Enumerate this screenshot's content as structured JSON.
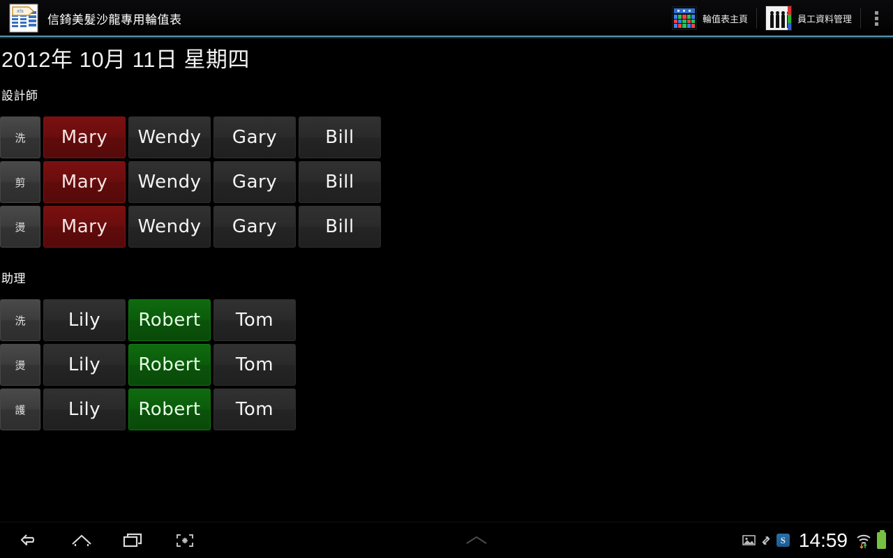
{
  "action_bar": {
    "app_icon": "spreadsheet-app-icon",
    "title": "信錡美髮沙龍專用輪值表",
    "actions": [
      {
        "icon": "calendar-grid-icon",
        "label": "輪值表主頁"
      },
      {
        "icon": "staff-people-icon",
        "label": "員工資料管理"
      }
    ],
    "overflow": "overflow-menu-icon",
    "underline_color": "#5a93ad"
  },
  "content": {
    "date_header": "2012年 10月 11日 星期四",
    "sections": [
      {
        "label": "設計師",
        "rows": [
          {
            "label": "洗",
            "cells": [
              {
                "name": "Mary",
                "highlight": "red"
              },
              {
                "name": "Wendy",
                "highlight": "none"
              },
              {
                "name": "Gary",
                "highlight": "none"
              },
              {
                "name": "Bill",
                "highlight": "none"
              }
            ]
          },
          {
            "label": "剪",
            "cells": [
              {
                "name": "Mary",
                "highlight": "red"
              },
              {
                "name": "Wendy",
                "highlight": "none"
              },
              {
                "name": "Gary",
                "highlight": "none"
              },
              {
                "name": "Bill",
                "highlight": "none"
              }
            ]
          },
          {
            "label": "燙",
            "cells": [
              {
                "name": "Mary",
                "highlight": "red"
              },
              {
                "name": "Wendy",
                "highlight": "none"
              },
              {
                "name": "Gary",
                "highlight": "none"
              },
              {
                "name": "Bill",
                "highlight": "none"
              }
            ]
          }
        ]
      },
      {
        "label": "助理",
        "rows": [
          {
            "label": "洗",
            "cells": [
              {
                "name": "Lily",
                "highlight": "none"
              },
              {
                "name": "Robert",
                "highlight": "green"
              },
              {
                "name": "Tom",
                "highlight": "none"
              }
            ]
          },
          {
            "label": "燙",
            "cells": [
              {
                "name": "Lily",
                "highlight": "none"
              },
              {
                "name": "Robert",
                "highlight": "green"
              },
              {
                "name": "Tom",
                "highlight": "none"
              }
            ]
          },
          {
            "label": "護",
            "cells": [
              {
                "name": "Lily",
                "highlight": "none"
              },
              {
                "name": "Robert",
                "highlight": "green"
              },
              {
                "name": "Tom",
                "highlight": "none"
              }
            ]
          }
        ]
      }
    ],
    "highlight_colors": {
      "red": "#6b0d0d",
      "green": "#0b5c0b",
      "default": "#262626"
    }
  },
  "nav_bar": {
    "buttons": [
      {
        "icon": "back-icon"
      },
      {
        "icon": "home-icon"
      },
      {
        "icon": "recent-apps-icon"
      },
      {
        "icon": "screenshot-icon"
      }
    ],
    "center": {
      "icon": "chevron-up-icon"
    },
    "status_tray": {
      "icons": [
        "image-icon",
        "sync-icon",
        "s-app-badge-icon",
        "wifi-icon",
        "battery-icon"
      ],
      "s_badge_text": "S",
      "clock": "14:59"
    }
  }
}
